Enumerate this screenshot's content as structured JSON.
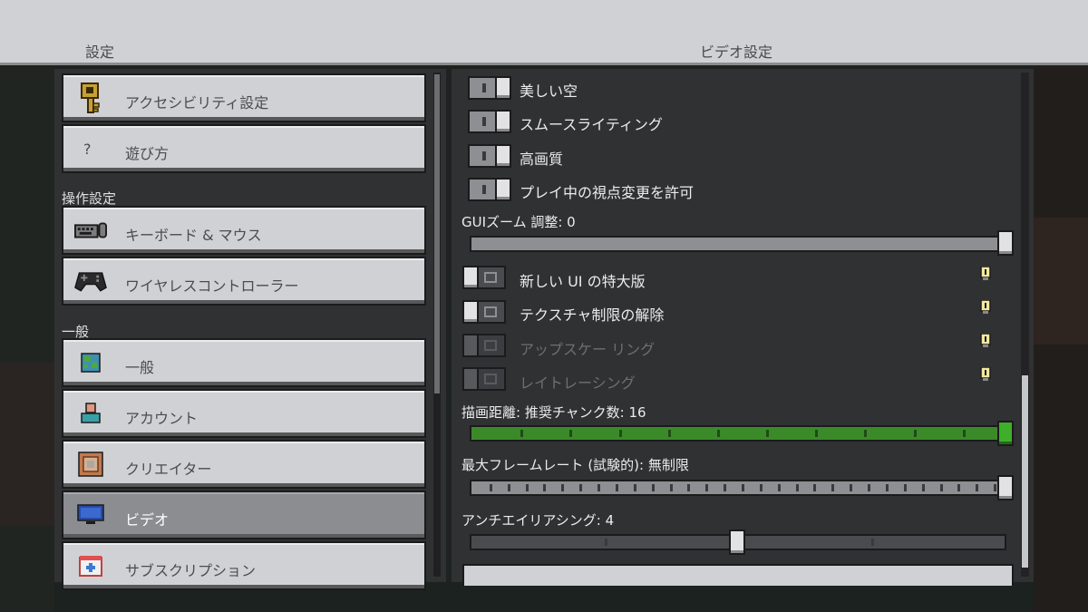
{
  "header": {
    "left_title": "設定",
    "right_title": "ビデオ設定"
  },
  "sidebar": {
    "items": [
      {
        "label": "アクセシビリティ設定",
        "icon": "key-icon"
      },
      {
        "label": "遊び方",
        "icon": "question-icon",
        "glyph": "?"
      },
      {
        "label": "キーボード & マウス",
        "icon": "keyboard-mouse-icon"
      },
      {
        "label": "ワイヤレスコントローラー",
        "icon": "gamepad-icon"
      },
      {
        "label": "一般",
        "icon": "globe-icon"
      },
      {
        "label": "アカウント",
        "icon": "account-icon"
      },
      {
        "label": "クリエイター",
        "icon": "creator-icon"
      },
      {
        "label": "ビデオ",
        "icon": "monitor-icon",
        "active": true
      },
      {
        "label": "サブスクリプション",
        "icon": "subscription-icon"
      }
    ],
    "sections": {
      "controls": "操作設定",
      "general": "一般"
    }
  },
  "video": {
    "toggles": [
      {
        "label": "美しい空",
        "state": "on"
      },
      {
        "label": "スムースライティング",
        "state": "on"
      },
      {
        "label": "高画質",
        "state": "on"
      },
      {
        "label": "プレイ中の視点変更を許可",
        "state": "on"
      }
    ],
    "gui_scale": {
      "label": "GUIズーム 調整: 0",
      "value": 1.0
    },
    "toggles2": [
      {
        "label": "新しい UI の特大版",
        "state": "off",
        "enabled": true
      },
      {
        "label": "テクスチャ制限の解除",
        "state": "off",
        "enabled": true
      },
      {
        "label": "アップスケー リング",
        "state": "off",
        "enabled": false
      },
      {
        "label": "レイトレーシング",
        "state": "off",
        "enabled": false
      }
    ],
    "render_distance": {
      "label": "描画距離: 推奨チャンク数: 16",
      "value": 1.0
    },
    "max_framerate": {
      "label": "最大フレームレート (試験的): 無制限",
      "value": 1.0
    },
    "antialiasing": {
      "label": "アンチエイリアシング: 4",
      "value": 0.5
    }
  },
  "colors": {
    "accent_green": "#3fae2a",
    "panel": "#303133",
    "header": "#d0d1d4"
  }
}
